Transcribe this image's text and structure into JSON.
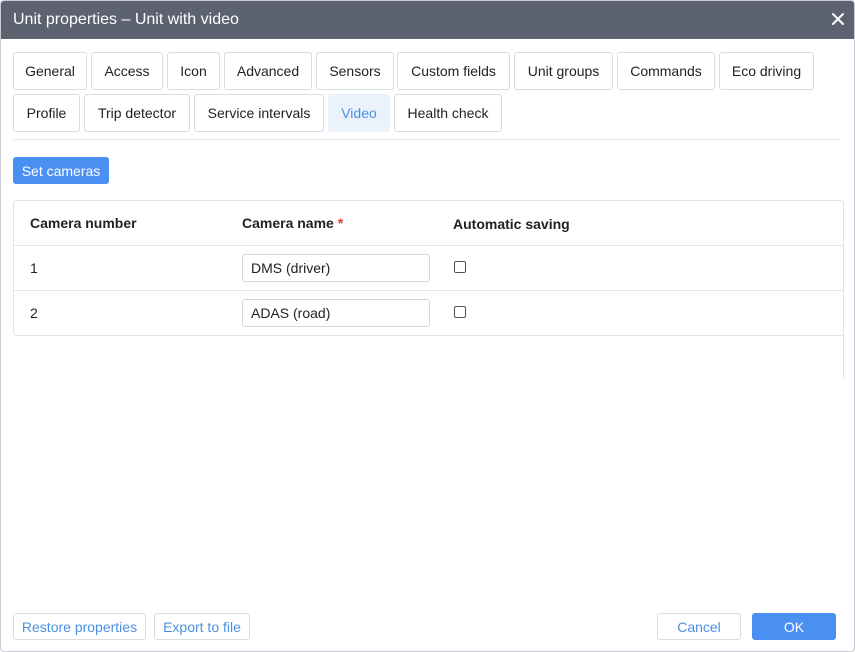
{
  "window": {
    "title": "Unit properties – Unit with video"
  },
  "tabs": [
    {
      "label": "General"
    },
    {
      "label": "Access"
    },
    {
      "label": "Icon"
    },
    {
      "label": "Advanced"
    },
    {
      "label": "Sensors"
    },
    {
      "label": "Custom fields"
    },
    {
      "label": "Unit groups"
    },
    {
      "label": "Commands"
    },
    {
      "label": "Eco driving"
    },
    {
      "label": "Profile"
    },
    {
      "label": "Trip detector"
    },
    {
      "label": "Service intervals"
    },
    {
      "label": "Video",
      "active": true
    },
    {
      "label": "Health check"
    }
  ],
  "video": {
    "set_cameras_label": "Set cameras",
    "columns": {
      "camera_number": "Camera number",
      "camera_name": "Camera name",
      "required_mark": "*",
      "automatic_saving": "Automatic saving"
    },
    "rows": [
      {
        "number": "1",
        "name": "DMS (driver)",
        "auto_save": false
      },
      {
        "number": "2",
        "name": "ADAS (road)",
        "auto_save": false
      }
    ]
  },
  "footer": {
    "restore_label": "Restore properties",
    "export_label": "Export to file",
    "cancel_label": "Cancel",
    "ok_label": "OK"
  },
  "colors": {
    "titlebar": "#5c6270",
    "accent": "#4a90f2",
    "active_tab_bg": "#eaf2fb"
  }
}
